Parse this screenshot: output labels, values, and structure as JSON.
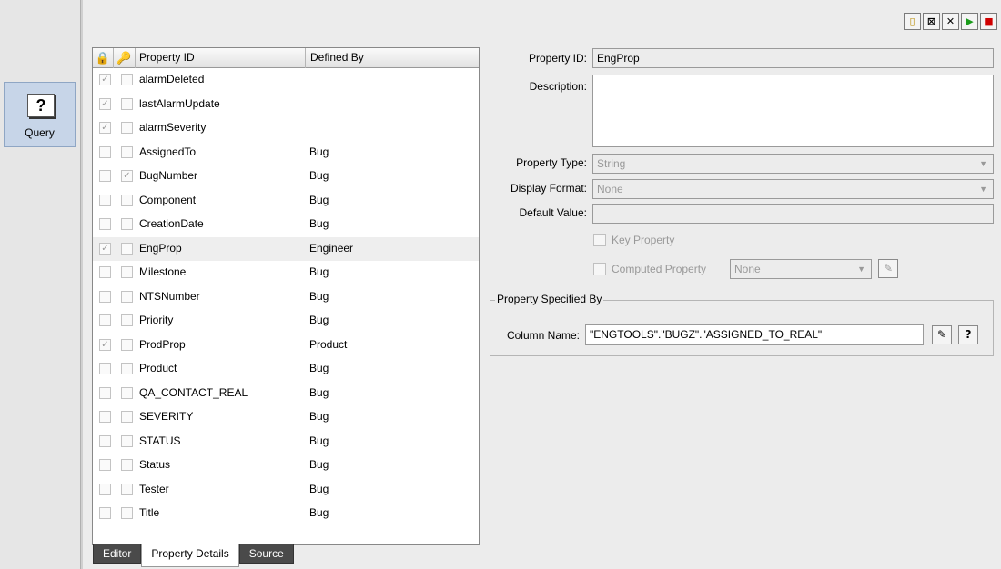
{
  "leftnav": {
    "query_label": "Query",
    "query_icon": "?"
  },
  "toolbar": [
    {
      "icon": "new-icon",
      "glyph": "▯"
    },
    {
      "icon": "close-all-icon",
      "glyph": "⊠"
    },
    {
      "icon": "delete-icon",
      "glyph": "✕"
    },
    {
      "icon": "play-icon",
      "glyph": "▶"
    },
    {
      "icon": "stop-icon",
      "glyph": "■"
    }
  ],
  "table": {
    "headers": {
      "lock_icon": "🔒",
      "key_icon": "🔑",
      "property_id": "Property ID",
      "defined_by": "Defined By"
    },
    "rows": [
      {
        "id": "alarmDeleted",
        "by": "",
        "c1": true,
        "c2": false
      },
      {
        "id": "lastAlarmUpdate",
        "by": "",
        "c1": true,
        "c2": false
      },
      {
        "id": "alarmSeverity",
        "by": "",
        "c1": true,
        "c2": false
      },
      {
        "id": "AssignedTo",
        "by": "Bug",
        "c1": false,
        "c2": false
      },
      {
        "id": "BugNumber",
        "by": "Bug",
        "c1": false,
        "c2": true
      },
      {
        "id": "Component",
        "by": "Bug",
        "c1": false,
        "c2": false
      },
      {
        "id": "CreationDate",
        "by": "Bug",
        "c1": false,
        "c2": false
      },
      {
        "id": "EngProp",
        "by": "Engineer",
        "c1": true,
        "c2": false,
        "selected": true
      },
      {
        "id": "Milestone",
        "by": "Bug",
        "c1": false,
        "c2": false
      },
      {
        "id": "NTSNumber",
        "by": "Bug",
        "c1": false,
        "c2": false
      },
      {
        "id": "Priority",
        "by": "Bug",
        "c1": false,
        "c2": false
      },
      {
        "id": "ProdProp",
        "by": "Product",
        "c1": true,
        "c2": false
      },
      {
        "id": "Product",
        "by": "Bug",
        "c1": false,
        "c2": false
      },
      {
        "id": "QA_CONTACT_REAL",
        "by": "Bug",
        "c1": false,
        "c2": false
      },
      {
        "id": "SEVERITY",
        "by": "Bug",
        "c1": false,
        "c2": false
      },
      {
        "id": "STATUS",
        "by": "Bug",
        "c1": false,
        "c2": false
      },
      {
        "id": "Status",
        "by": "Bug",
        "c1": false,
        "c2": false
      },
      {
        "id": "Tester",
        "by": "Bug",
        "c1": false,
        "c2": false
      },
      {
        "id": "Title",
        "by": "Bug",
        "c1": false,
        "c2": false
      }
    ]
  },
  "details": {
    "property_id_label": "Property ID:",
    "property_id_value": "EngProp",
    "description_label": "Description:",
    "description_value": "",
    "property_type_label": "Property Type:",
    "property_type_value": "String",
    "display_format_label": "Display Format:",
    "display_format_value": "None",
    "default_value_label": "Default Value:",
    "default_value_value": "",
    "key_property_label": "Key Property",
    "computed_property_label": "Computed Property",
    "computed_property_value": "None",
    "group_title": "Property Specified By",
    "column_name_label": "Column Name:",
    "column_name_value": "\"ENGTOOLS\".\"BUGZ\".\"ASSIGNED_TO_REAL\"",
    "edit_icon": "✎",
    "help_label": "?"
  },
  "tabs": [
    {
      "label": "Editor",
      "active": false
    },
    {
      "label": "Property Details",
      "active": true
    },
    {
      "label": "Source",
      "active": false
    }
  ]
}
